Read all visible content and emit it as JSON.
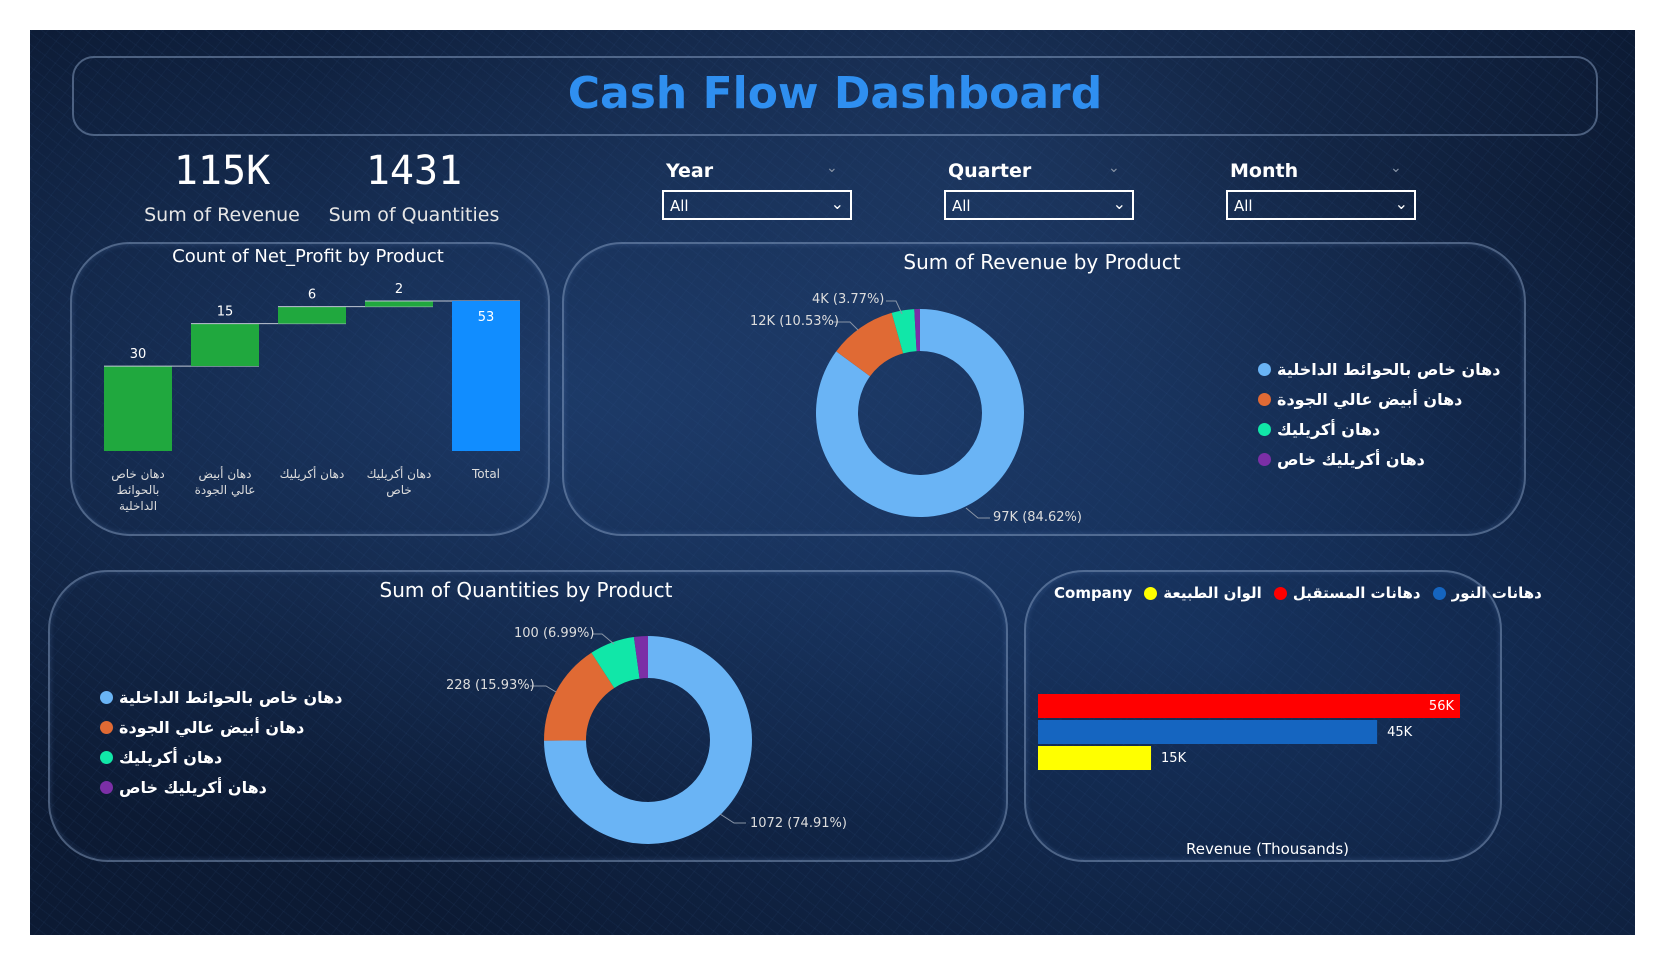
{
  "dashboard": {
    "title": "Cash Flow Dashboard"
  },
  "kpis": [
    {
      "value": "115K",
      "label": "Sum of Revenue"
    },
    {
      "value": "1431",
      "label": "Sum of Quantities"
    }
  ],
  "slicers": [
    {
      "label": "Year",
      "value": "All"
    },
    {
      "label": "Quarter",
      "value": "All"
    },
    {
      "label": "Month",
      "value": "All"
    }
  ],
  "colors": {
    "light_blue": "#6ab4f5",
    "orange": "#e06a34",
    "teal": "#11e7a8",
    "purple": "#7b2fa6",
    "green": "#20a83e",
    "total_blue": "#118dff",
    "red": "#ff0000",
    "blue": "#1565c0",
    "yellow": "#ffff00"
  },
  "chart_data": [
    {
      "type": "bar",
      "subtype": "waterfall",
      "title": "Count of Net_Profit by Product",
      "categories": [
        "دهان خاص بالحوائط الداخلية",
        "دهان أبيض عالي الجودة",
        "دهان أكريليك",
        "دهان أكريليك خاص",
        "Total"
      ],
      "values": [
        30,
        15,
        6,
        2,
        53
      ],
      "data_labels": [
        "30",
        "15",
        "6",
        "2",
        "53"
      ]
    },
    {
      "type": "pie",
      "subtype": "donut",
      "title": "Sum of Revenue by Product",
      "labels": [
        "دهان خاص بالحوائط الداخلية",
        "دهان أبيض عالي الجودة",
        "دهان أكريليك",
        "دهان أكريليك خاص"
      ],
      "values": [
        97,
        12,
        4,
        1
      ],
      "data_labels": [
        "97K (84.62%)",
        "12K (10.53%)",
        "4K (3.77%)"
      ]
    },
    {
      "type": "pie",
      "subtype": "donut",
      "title": "Sum of Quantities by Product",
      "labels": [
        "دهان خاص بالحوائط الداخلية",
        "دهان أبيض عالي الجودة",
        "دهان أكريليك",
        "دهان أكريليك خاص"
      ],
      "values": [
        1072,
        228,
        100,
        31
      ],
      "data_labels": [
        "1072 (74.91%)",
        "228 (15.93%)",
        "100 (6.99%)"
      ]
    },
    {
      "type": "bar",
      "orientation": "horizontal",
      "legend_title": "Company",
      "legend": [
        "الوان الطبيعة",
        "دهانات المستقبل",
        "دهانات النور"
      ],
      "categories": [
        "دهانات المستقبل",
        "دهانات النور",
        "الوان الطبيعة"
      ],
      "values": [
        56,
        45,
        15
      ],
      "data_labels": [
        "56K",
        "45K",
        "15K"
      ],
      "xlabel": "Revenue (Thousands)"
    }
  ]
}
